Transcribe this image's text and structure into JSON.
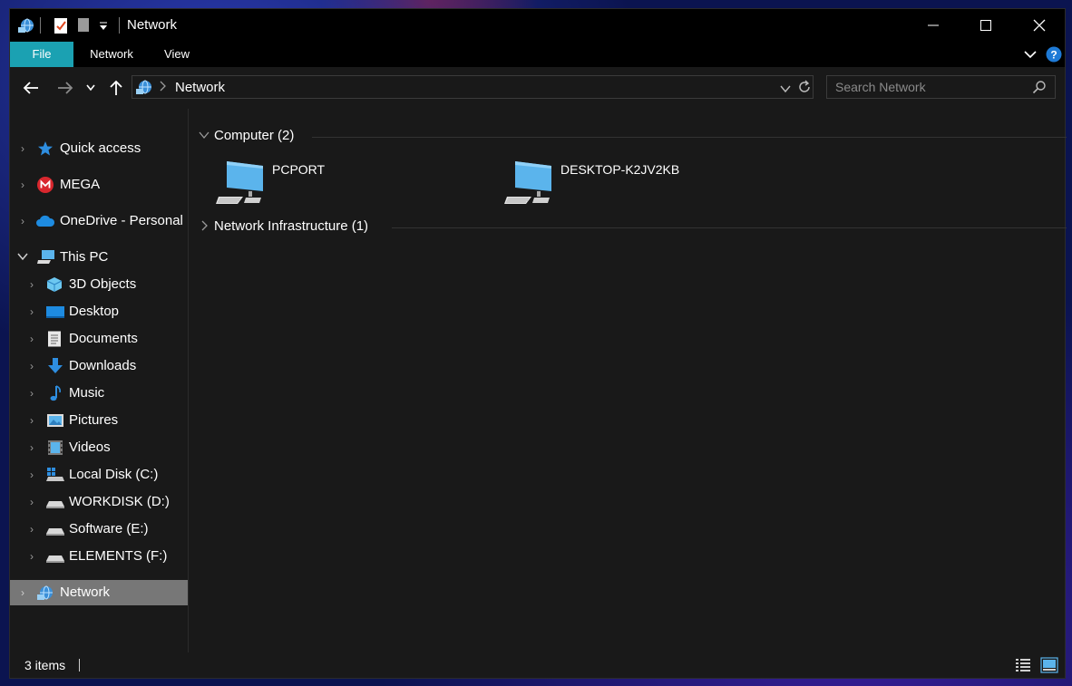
{
  "window": {
    "title": "Network",
    "minimize_label": "",
    "maximize_label": "",
    "close_label": ""
  },
  "ribbon": {
    "tabs": [
      {
        "label": "File"
      },
      {
        "label": "Network"
      },
      {
        "label": "View"
      }
    ]
  },
  "addressbar": {
    "path": "Network",
    "search_placeholder": "Search Network"
  },
  "sidebar": {
    "items": [
      {
        "label": "Quick access",
        "icon": "star-icon"
      },
      {
        "label": "MEGA",
        "icon": "mega-icon"
      },
      {
        "label": "OneDrive - Personal",
        "icon": "cloud-icon"
      },
      {
        "label": "This PC",
        "icon": "computer-icon"
      },
      {
        "label": "3D Objects",
        "icon": "cube-icon"
      },
      {
        "label": "Desktop",
        "icon": "desktop-icon"
      },
      {
        "label": "Documents",
        "icon": "document-icon"
      },
      {
        "label": "Downloads",
        "icon": "download-icon"
      },
      {
        "label": "Music",
        "icon": "music-icon"
      },
      {
        "label": "Pictures",
        "icon": "pictures-icon"
      },
      {
        "label": "Videos",
        "icon": "video-icon"
      },
      {
        "label": "Local Disk (C:)",
        "icon": "system-drive-icon"
      },
      {
        "label": "WORKDISK (D:)",
        "icon": "drive-icon"
      },
      {
        "label": "Software (E:)",
        "icon": "drive-icon"
      },
      {
        "label": "ELEMENTS (F:)",
        "icon": "drive-icon"
      },
      {
        "label": "Network",
        "icon": "network-icon"
      }
    ]
  },
  "content": {
    "groups": [
      {
        "title": "Computer (2)",
        "expanded": true,
        "items": [
          {
            "name": "PCPORT"
          },
          {
            "name": "DESKTOP-K2JV2KB"
          }
        ]
      },
      {
        "title": "Network Infrastructure (1)",
        "expanded": false,
        "items": []
      }
    ]
  },
  "status": {
    "items_count": "3 items"
  },
  "colors": {
    "accent": "#1ba1b2",
    "selected": "#777777",
    "background": "#191919",
    "titlebar": "#000000",
    "help": "#1e7ad6"
  }
}
